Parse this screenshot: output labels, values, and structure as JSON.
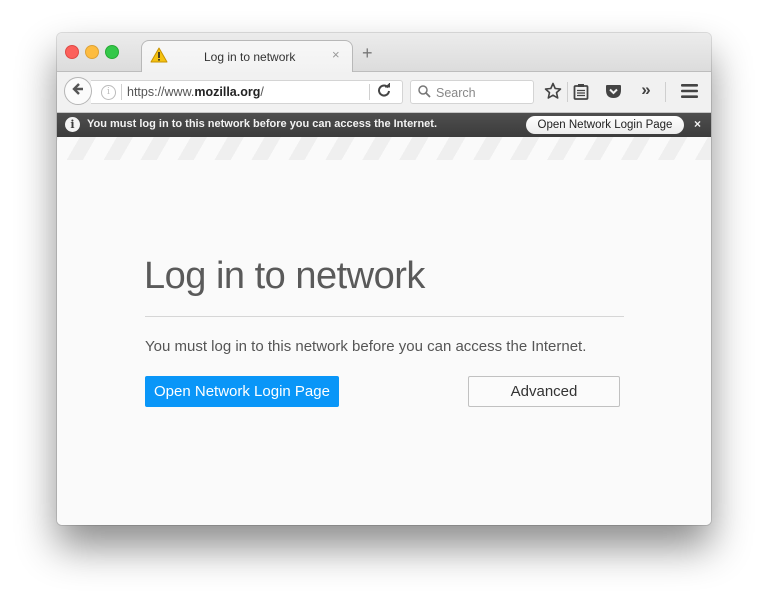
{
  "window": {
    "traffic_lights": [
      "close",
      "minimize",
      "maximize"
    ]
  },
  "tab": {
    "icon": "warning-icon",
    "title": "Log in to network",
    "close_glyph": "×",
    "new_tab_glyph": "+"
  },
  "toolbar": {
    "back_icon": "back-arrow-icon",
    "url_prefix": "https://www.",
    "url_domain": "mozilla.org",
    "url_suffix": "/",
    "reload_glyph": "C",
    "search_placeholder": "Search",
    "icons": [
      "bookmark-star-icon",
      "reading-list-icon",
      "pocket-icon",
      "overflow-chevron-icon",
      "menu-hamburger-icon"
    ],
    "overflow_glyph": "»"
  },
  "notification": {
    "message": "You must log in to this network before you can access the Internet.",
    "button_label": "Open Network Login Page",
    "close_glyph": "×"
  },
  "page": {
    "title": "Log in to network",
    "description": "You must log in to this network before you can access the Internet.",
    "primary_button": "Open Network Login Page",
    "secondary_button": "Advanced",
    "accent_color": "#0996f8"
  }
}
